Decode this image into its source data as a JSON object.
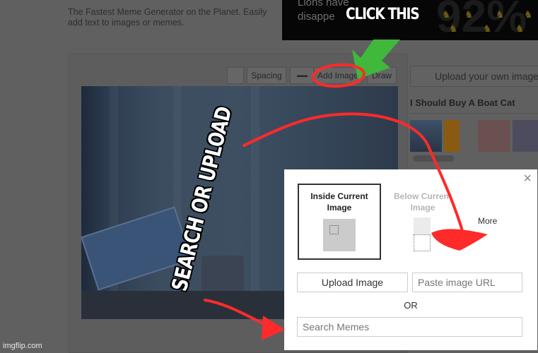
{
  "header": {
    "tagline": "The Fastest Meme Generator on the Planet. Easily add text to images or memes."
  },
  "ad": {
    "text_line1": "Lions have",
    "text_line2": "disappe",
    "stat": "92%",
    "lion_icon": "lion-icon"
  },
  "toolbar": {
    "buttons": [
      {
        "label": ""
      },
      {
        "label": "Spacing"
      },
      {
        "label": "▬▬",
        "icon": "sunglasses-icon"
      },
      {
        "label": "Add Image"
      },
      {
        "label": "Draw"
      }
    ]
  },
  "sidebar": {
    "upload_label": "Upload your own image",
    "template_title": "I Should Buy A Boat Cat"
  },
  "dialog": {
    "close_icon": "×",
    "option_inside": "Inside Current Image",
    "option_below": "Below Current Image",
    "more_label": "More",
    "upload_button": "Upload Image",
    "url_placeholder": "Paste image URL",
    "or_label": "OR",
    "search_placeholder": "Search Memes"
  },
  "annotations": {
    "click_this": "CLICK THIS",
    "search_or_upload": "SEARCH OR UPLOAD",
    "arrow_color": "#ff2a2a",
    "green_arrow_color": "#3fb83c"
  },
  "watermark": "imgflip.com"
}
